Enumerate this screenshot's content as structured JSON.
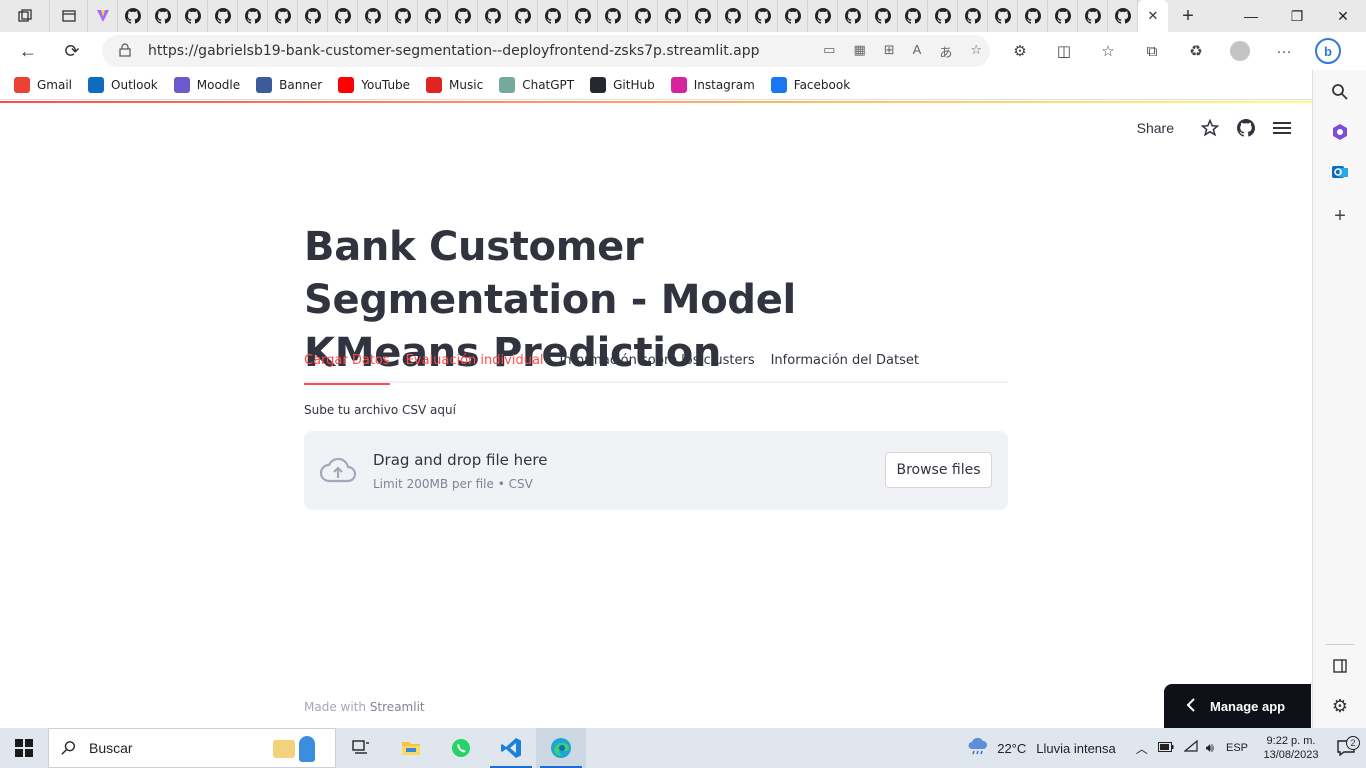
{
  "browser": {
    "url": "https://gabrielsb19-bank-customer-segmentation--deployfrontend-zsks7p.streamlit.app",
    "bookmarks": [
      {
        "label": "Gmail",
        "icon": "gmail-icon",
        "color": "#ea4335"
      },
      {
        "label": "Outlook",
        "icon": "outlook-icon",
        "color": "#0f6cbd"
      },
      {
        "label": "Moodle",
        "icon": "moodle-icon",
        "color": "#6a5acd"
      },
      {
        "label": "Banner",
        "icon": "banner-icon",
        "color": "#3b5b9a"
      },
      {
        "label": "YouTube",
        "icon": "youtube-icon",
        "color": "#ff0000"
      },
      {
        "label": "Music",
        "icon": "music-icon",
        "color": "#e02424"
      },
      {
        "label": "ChatGPT",
        "icon": "chatgpt-icon",
        "color": "#74aa9c"
      },
      {
        "label": "GitHub",
        "icon": "github-icon",
        "color": "#24292f"
      },
      {
        "label": "Instagram",
        "icon": "instagram-icon",
        "color": "#d6249f"
      },
      {
        "label": "Facebook",
        "icon": "facebook-icon",
        "color": "#1877f2"
      }
    ]
  },
  "app": {
    "header": {
      "share_label": "Share"
    },
    "title": "Bank Customer Segmentation - Model KMeans Prediction",
    "tabs": [
      {
        "label": "Cargar Datos",
        "state": "active"
      },
      {
        "label": "Evaluación individual",
        "state": "hover"
      },
      {
        "label": "Información sobre los clusters",
        "state": "normal"
      },
      {
        "label": "Información del Datset",
        "state": "normal"
      }
    ],
    "uploader": {
      "label": "Sube tu archivo CSV aquí",
      "main_text": "Drag and drop file here",
      "sub_text": "Limit 200MB per file • CSV",
      "button_label": "Browse files"
    },
    "footer": {
      "prefix": "Made with",
      "brand": "Streamlit"
    },
    "manage_label": "Manage app",
    "accent_color": "#ff4b4b"
  },
  "taskbar": {
    "search_placeholder": "Buscar",
    "weather_temp": "22°C",
    "weather_text": "Lluvia intensa",
    "language": "ESP",
    "time": "9:22 p. m.",
    "date": "13/08/2023",
    "notifications": "2"
  }
}
